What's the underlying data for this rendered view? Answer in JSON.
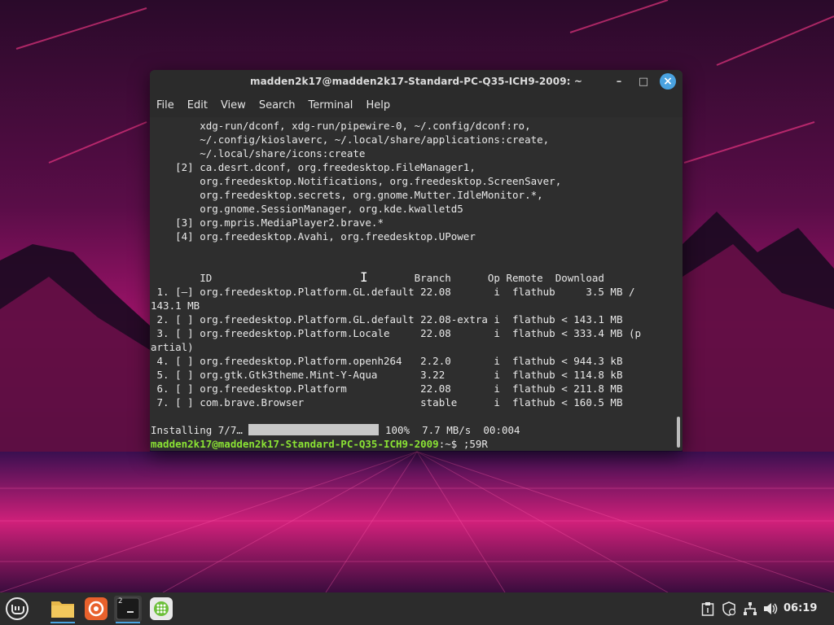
{
  "window": {
    "title": "madden2k17@madden2k17-Standard-PC-Q35-ICH9-2009: ~",
    "controls": {
      "minimize": "–",
      "maximize": "□",
      "close": "×"
    }
  },
  "menu": [
    "File",
    "Edit",
    "View",
    "Search",
    "Terminal",
    "Help"
  ],
  "terminal": {
    "lines": [
      "        xdg-run/dconf, xdg-run/pipewire-0, ~/.config/dconf:ro,",
      "        ~/.config/kioslaverc, ~/.local/share/applications:create,",
      "        ~/.local/share/icons:create",
      "    [2] ca.desrt.dconf, org.freedesktop.FileManager1,",
      "        org.freedesktop.Notifications, org.freedesktop.ScreenSaver,",
      "        org.freedesktop.secrets, org.gnome.Mutter.IdleMonitor.*,",
      "        org.gnome.SessionManager, org.kde.kwalletd5",
      "    [3] org.mpris.MediaPlayer2.brave.*",
      "    [4] org.freedesktop.Avahi, org.freedesktop.UPower",
      "",
      "",
      "        ID                                 Branch      Op Remote  Download",
      " 1. [–] org.freedesktop.Platform.GL.default 22.08       i  flathub     3.5 MB /",
      "143.1 MB",
      " 2. [ ] org.freedesktop.Platform.GL.default 22.08-extra i  flathub < 143.1 MB",
      " 3. [ ] org.freedesktop.Platform.Locale     22.08       i  flathub < 333.4 MB (p",
      "artial)",
      " 4. [ ] org.freedesktop.Platform.openh264   2.2.0       i  flathub < 944.3 kB",
      " 5. [ ] org.gtk.Gtk3theme.Mint-Y-Aqua       3.22        i  flathub < 114.8 kB",
      " 6. [ ] org.freedesktop.Platform            22.08       i  flathub < 211.8 MB",
      " 7. [ ] com.brave.Browser                   stable      i  flathub < 160.5 MB",
      ""
    ],
    "progress": {
      "label": "Installing 7/7…",
      "percent_text": "100%",
      "speed": "7.7 MB/s",
      "time": "00:004",
      "fraction": 1.0
    },
    "prompt": {
      "user_host": "madden2k17@madden2k17-Standard-PC-Q35-ICH9-2009",
      "path_symbol": ":~$ ",
      "input": ";59R"
    }
  },
  "taskbar": {
    "terminal_badge": "2",
    "clock": "06:19"
  },
  "colors": {
    "terminal_bg": "#2e2e2e",
    "prompt_green": "#8ae234",
    "accent_blue": "#4aa3e0",
    "taskbar_bg": "#2c2c2c"
  }
}
